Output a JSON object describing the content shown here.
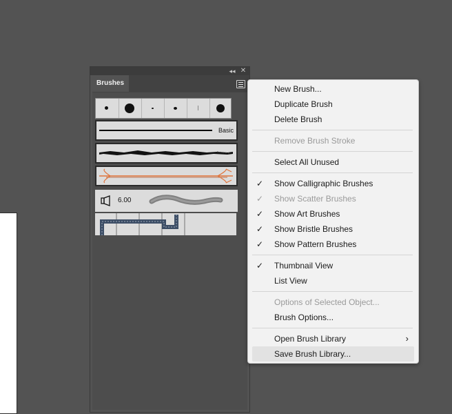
{
  "panel": {
    "tab_label": "Brushes",
    "collapse_icon": "double-chevron-left-icon",
    "close_icon": "close-icon",
    "menu_button_icon": "hamburger-menu-icon",
    "brushes": {
      "basic_label": "Basic",
      "bristle_size": "6.00",
      "bristle_icon": "bristle-brush-icon"
    }
  },
  "menu": {
    "items": [
      {
        "label": "New Brush...",
        "enabled": true,
        "checked": false
      },
      {
        "label": "Duplicate Brush",
        "enabled": true,
        "checked": false
      },
      {
        "label": "Delete Brush",
        "enabled": true,
        "checked": false
      },
      {
        "label": "Remove Brush Stroke",
        "enabled": false,
        "checked": false
      },
      {
        "label": "Select All Unused",
        "enabled": true,
        "checked": false
      },
      {
        "label": "Show Calligraphic Brushes",
        "enabled": true,
        "checked": true
      },
      {
        "label": "Show Scatter Brushes",
        "enabled": false,
        "checked": true
      },
      {
        "label": "Show Art Brushes",
        "enabled": true,
        "checked": true
      },
      {
        "label": "Show Bristle Brushes",
        "enabled": true,
        "checked": true
      },
      {
        "label": "Show Pattern Brushes",
        "enabled": true,
        "checked": true
      },
      {
        "label": "Thumbnail View",
        "enabled": true,
        "checked": true
      },
      {
        "label": "List View",
        "enabled": true,
        "checked": false
      },
      {
        "label": "Options of Selected Object...",
        "enabled": false,
        "checked": false
      },
      {
        "label": "Brush Options...",
        "enabled": true,
        "checked": false
      },
      {
        "label": "Open Brush Library",
        "enabled": true,
        "checked": false,
        "submenu": true
      },
      {
        "label": "Save Brush Library...",
        "enabled": true,
        "checked": false,
        "hovered": true
      }
    ],
    "check_glyph": "✓",
    "submenu_glyph": "›"
  },
  "colors": {
    "background": "#535353",
    "menu_bg": "#f2f2f2",
    "menu_hover": "#e2e2e2",
    "disabled_text": "#9a9a9a",
    "art_brush_accent": "#e0733a"
  }
}
